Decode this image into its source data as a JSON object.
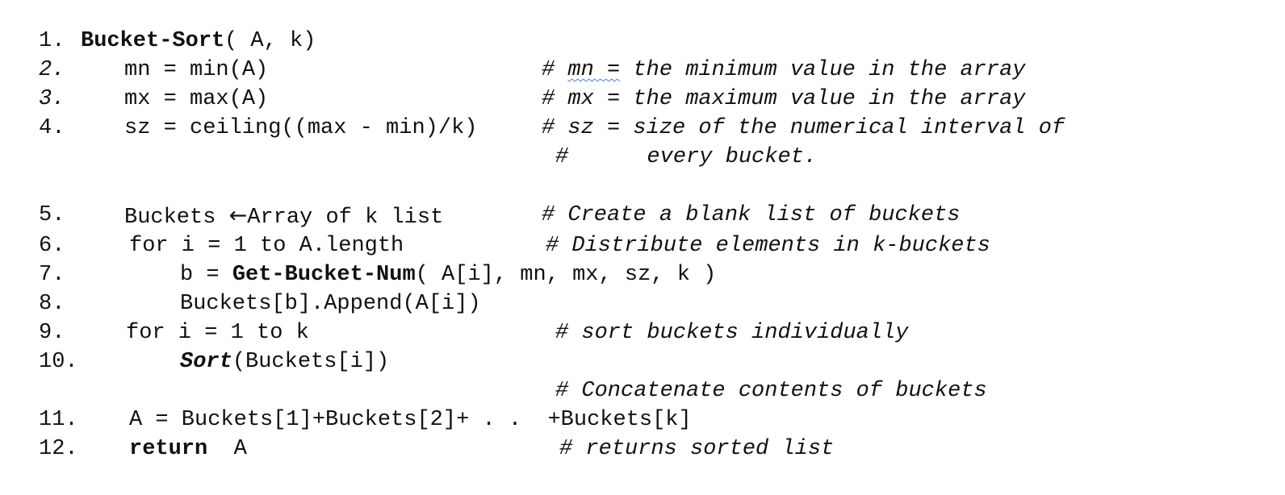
{
  "lines": [
    {
      "num": "1.",
      "func": "Bucket-Sort",
      "rest": "( A, k)"
    },
    {
      "num": "2.",
      "code": "mn = min(A)",
      "comment_hash": "# ",
      "comment_var": "mn =",
      "comment_rest": " the minimum value in the array"
    },
    {
      "num": "3.",
      "code": "mx = max(A)",
      "comment": "# mx = the maximum value in the array"
    },
    {
      "num": "4.",
      "code": "sz = ceiling((max - min)/k)",
      "comment": "# sz = size of the numerical interval of"
    },
    {
      "comment_cont": "#      every bucket."
    },
    {
      "num": "5.",
      "code_pre": "Buckets ",
      "arrow": "←",
      "code_post": "Array of k list",
      "comment": "# Create a blank list of buckets"
    },
    {
      "num": "6.",
      "code": "for i = 1 to A.length",
      "comment": "# Distribute elements in k-buckets"
    },
    {
      "num": "7.",
      "code_pre": "b = ",
      "func": "Get-Bucket-Num",
      "code_post": "( A[i], mn, mx, sz, k )"
    },
    {
      "num": "8.",
      "code": "Buckets[b].Append(A[i])"
    },
    {
      "num": "9.",
      "code": "for i = 1 to k",
      "comment": "# sort buckets individually"
    },
    {
      "num": "10.",
      "func": "Sort",
      "code_post": "(Buckets[i])"
    },
    {
      "comment_cont": "# Concatenate contents of buckets"
    },
    {
      "num": "11.",
      "code": "A = Buckets[1]+Buckets[2]+ . .  +Buckets[k]"
    },
    {
      "num": "12.",
      "keyword": "return",
      "code_post": "  A",
      "comment": "# returns sorted list"
    }
  ]
}
